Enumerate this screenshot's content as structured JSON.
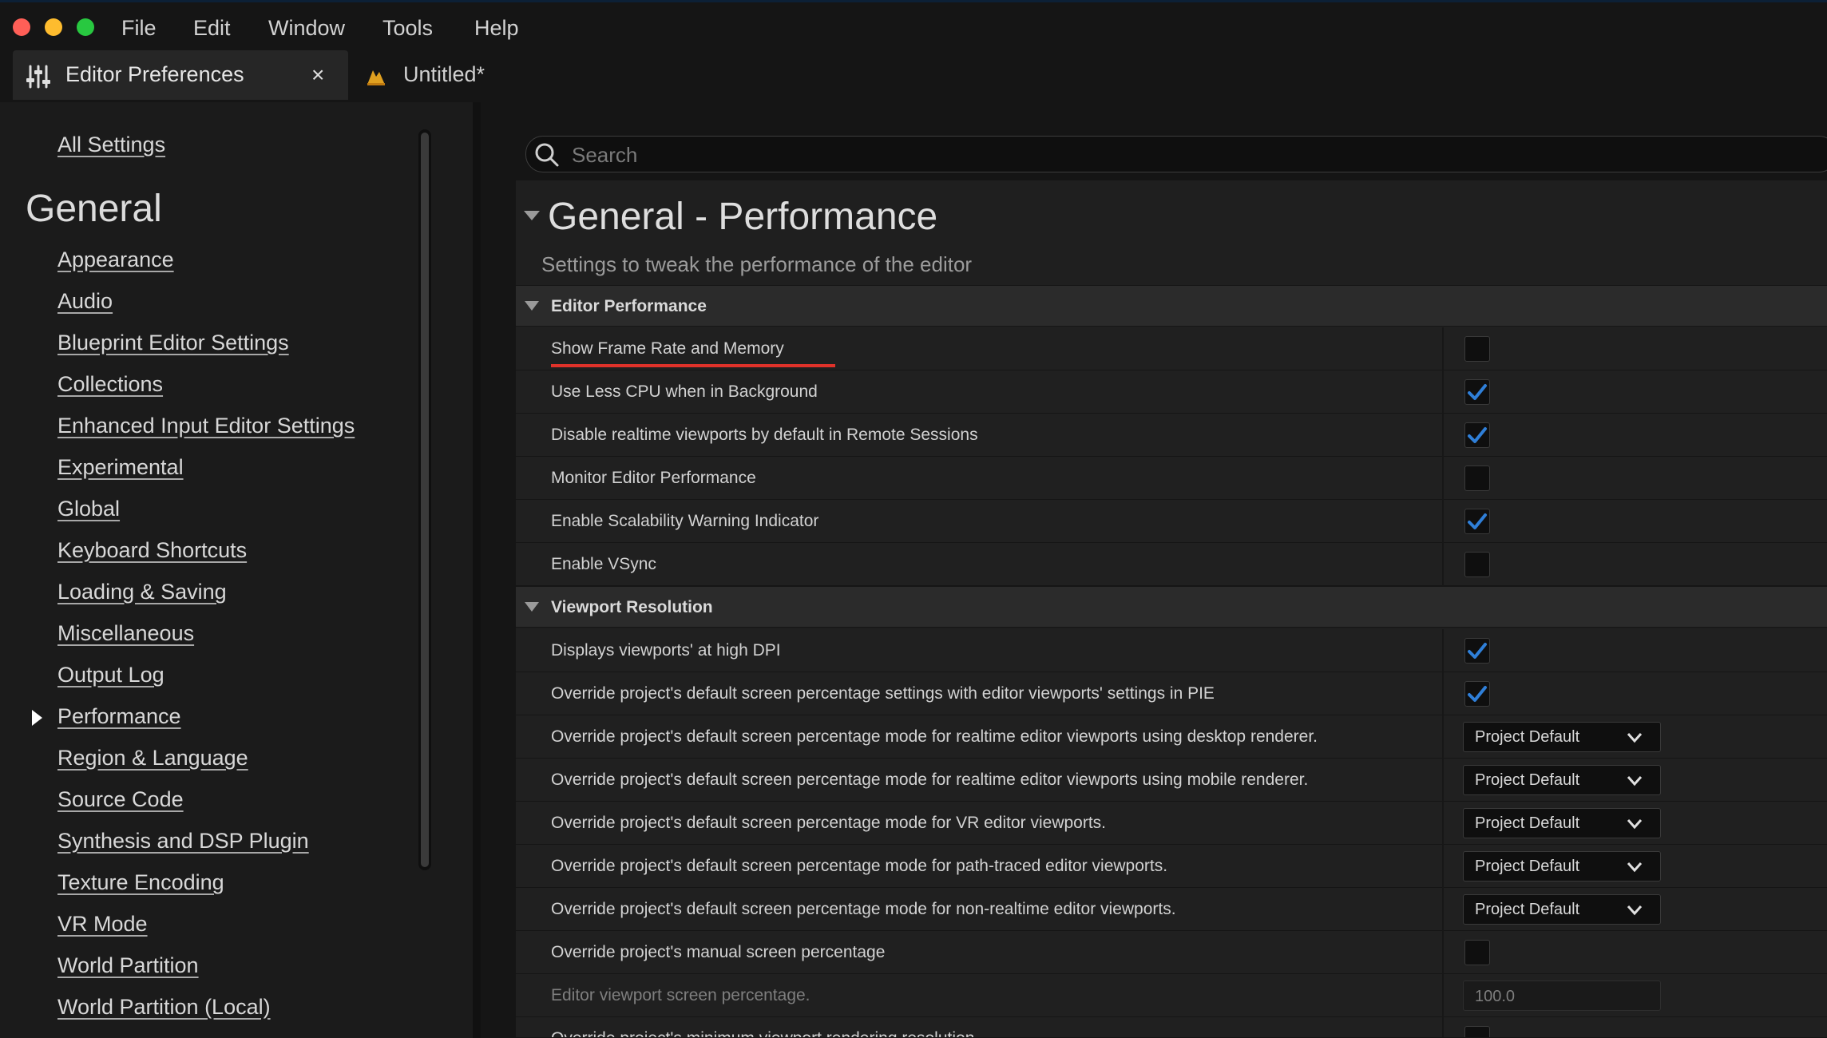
{
  "menu": {
    "items": [
      "File",
      "Edit",
      "Window",
      "Tools",
      "Help"
    ]
  },
  "tabs": [
    {
      "title": "Editor Preferences",
      "close": "×",
      "icon": "sliders-icon"
    },
    {
      "title": "Untitled*",
      "icon": "unreal-level-icon"
    }
  ],
  "nav": {
    "all_settings": "All Settings",
    "heading": "General",
    "items": [
      "Appearance",
      "Audio",
      "Blueprint Editor Settings",
      "Collections",
      "Enhanced Input Editor Settings",
      "Experimental",
      "Global",
      "Keyboard Shortcuts",
      "Loading & Saving",
      "Miscellaneous",
      "Output Log",
      "Performance",
      "Region & Language",
      "Source Code",
      "Synthesis and DSP Plugin",
      "Texture Encoding",
      "VR Mode",
      "World Partition",
      "World Partition (Local)"
    ],
    "selected": "Performance"
  },
  "search": {
    "placeholder": "Search"
  },
  "page": {
    "title": "General - Performance",
    "description": "Settings to tweak the performance of the editor"
  },
  "sections": [
    {
      "title": "Editor Performance",
      "rows": [
        {
          "label": "Show Frame Rate and Memory",
          "type": "checkbox",
          "checked": false
        },
        {
          "label": "Use Less CPU when in Background",
          "type": "checkbox",
          "checked": true
        },
        {
          "label": "Disable realtime viewports by default in Remote Sessions",
          "type": "checkbox",
          "checked": true
        },
        {
          "label": "Monitor Editor Performance",
          "type": "checkbox",
          "checked": false
        },
        {
          "label": "Enable Scalability Warning Indicator",
          "type": "checkbox",
          "checked": true
        },
        {
          "label": "Enable VSync",
          "type": "checkbox",
          "checked": false
        }
      ]
    },
    {
      "title": "Viewport Resolution",
      "rows": [
        {
          "label": "Displays viewports' at high DPI",
          "type": "checkbox",
          "checked": true
        },
        {
          "label": "Override project's default screen percentage settings with editor viewports' settings in PIE",
          "type": "checkbox",
          "checked": true
        },
        {
          "label": "Override project's default screen percentage mode for realtime editor viewports using desktop renderer.",
          "type": "combo",
          "value": "Project Default"
        },
        {
          "label": "Override project's default screen percentage mode for realtime editor viewports using mobile renderer.",
          "type": "combo",
          "value": "Project Default"
        },
        {
          "label": "Override project's default screen percentage mode for VR editor viewports.",
          "type": "combo",
          "value": "Project Default"
        },
        {
          "label": "Override project's default screen percentage mode for path-traced editor viewports.",
          "type": "combo",
          "value": "Project Default"
        },
        {
          "label": "Override project's default screen percentage mode for non-realtime editor viewports.",
          "type": "combo",
          "value": "Project Default"
        },
        {
          "label": "Override project's manual screen percentage",
          "type": "checkbox",
          "checked": false
        },
        {
          "label": "Editor viewport screen percentage.",
          "type": "number",
          "value": "100.0",
          "disabled": true
        },
        {
          "label": "Override project's minimum viewport rendering resolution",
          "type": "checkbox",
          "checked": false
        }
      ]
    }
  ],
  "colors": {
    "check": "#2f7fd8",
    "highlight_underline": "#e0322a",
    "close_button": "#ff5f57",
    "minimize_button": "#febc2e",
    "zoom_button": "#28c840"
  }
}
